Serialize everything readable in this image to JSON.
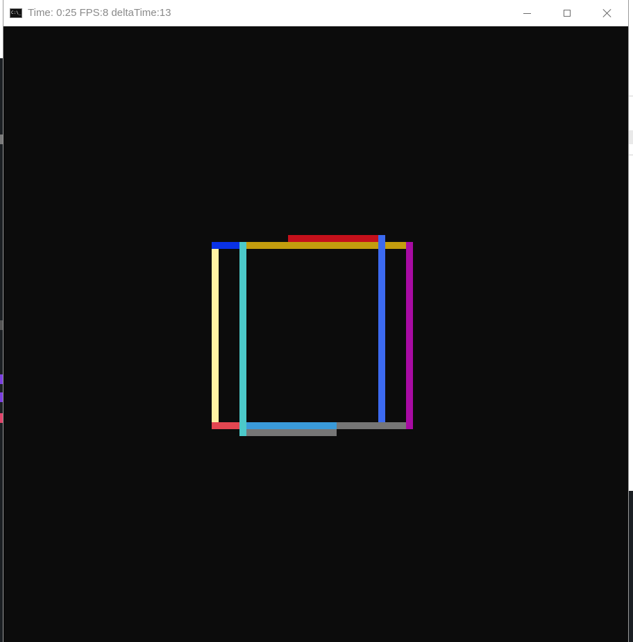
{
  "window": {
    "title": "Time: 0:25 FPS:8 deltaTime:13",
    "icon": "console-icon",
    "icon_text": "C:\\_"
  },
  "controls": {
    "minimize_icon": "minimize-icon",
    "maximize_icon": "maximize-icon",
    "close_icon": "close-icon"
  },
  "colors": {
    "title_bar": "#ffffff",
    "title_text": "#8a8a8a",
    "viewport_background": "#0c0c0c"
  },
  "scene": {
    "segments": [
      {
        "name": "blue-top-left-segment",
        "color": "#0a32e6"
      },
      {
        "name": "gold-top-segment",
        "color": "#c39d0e"
      },
      {
        "name": "red-top-segment",
        "color": "#c5101b"
      },
      {
        "name": "cream-left-segment",
        "color": "#fff2a4"
      },
      {
        "name": "cyan-left-segment",
        "color": "#4cc9c9"
      },
      {
        "name": "blue-right-segment",
        "color": "#3c6af0"
      },
      {
        "name": "magenta-right-segment",
        "color": "#a80ba3"
      },
      {
        "name": "coral-bottom-left-segment",
        "color": "#e34651"
      },
      {
        "name": "sky-blue-bottom-segment",
        "color": "#3a9ad9"
      },
      {
        "name": "gray-bottom-right-segment",
        "color": "#767676"
      },
      {
        "name": "gray-bottom-segment",
        "color": "#767676"
      }
    ]
  }
}
